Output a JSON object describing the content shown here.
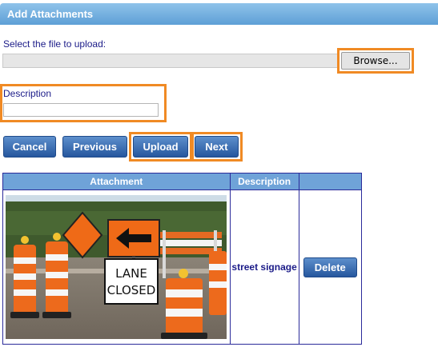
{
  "panel": {
    "title": "Add Attachments"
  },
  "upload": {
    "file_label": "Select the file to upload:",
    "browse_label": "Browse..."
  },
  "description": {
    "label": "Description",
    "value": ""
  },
  "buttons": {
    "cancel": "Cancel",
    "previous": "Previous",
    "upload": "Upload",
    "next": "Next"
  },
  "table": {
    "headers": [
      "Attachment",
      "Description",
      ""
    ],
    "rows": [
      {
        "image_alt": "road work barrels with LANE CLOSED sign",
        "description": "street signage",
        "delete_label": "Delete"
      }
    ]
  },
  "photo_sign": {
    "line1": "LANE",
    "line2": "CLOSED"
  },
  "colors": {
    "highlight": "#f08a24",
    "button": "#2e62ad",
    "header": "#6fa3d8",
    "text": "#1b1b88"
  }
}
